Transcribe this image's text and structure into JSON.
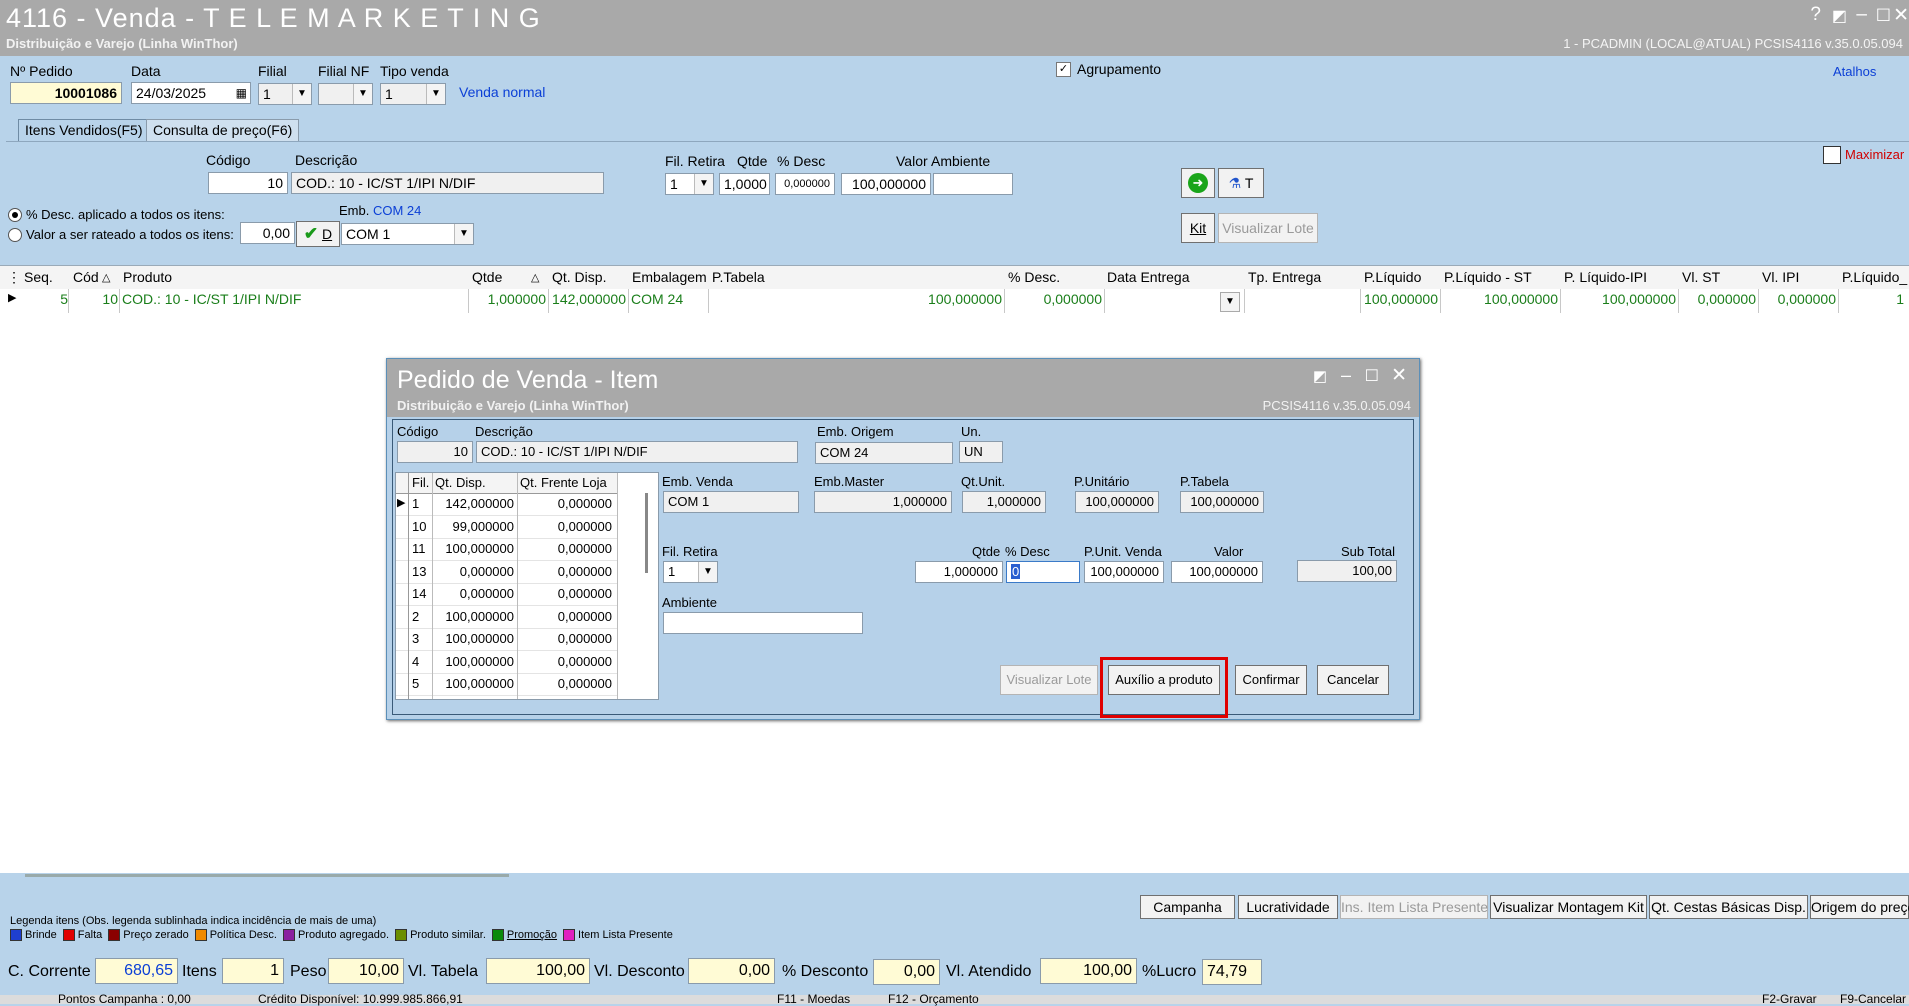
{
  "window": {
    "title": "4116 - Venda - T E L E M A R K E T I N G",
    "subtitle": "Distribuição e Varejo (Linha WinThor)",
    "right_info": "1 - PCADMIN (LOCAL@ATUAL)   PCSIS4116  v.35.0.05.094",
    "help": "?"
  },
  "header": {
    "pedido_label": "Nº Pedido",
    "pedido_value": "10001086",
    "data_label": "Data",
    "data_value": "24/03/2025",
    "filial_label": "Filial",
    "filial_value": "1",
    "filialnf_label": "Filial NF",
    "filialnf_value": "",
    "tipovenda_label": "Tipo venda",
    "tipovenda_value": "1",
    "tipovenda_desc": "Venda normal",
    "agrupamento_label": "Agrupamento",
    "atalhos_label": "Atalhos"
  },
  "tabs": [
    {
      "label": "Itens Vendidos(F5)"
    },
    {
      "label": "Consulta de preço(F6)"
    }
  ],
  "entry": {
    "codigo_label": "Código",
    "codigo_value": "10",
    "descricao_label": "Descrição",
    "descricao_value": "COD.: 10 - IC/ST 1/IPI N/DIF",
    "filretira_label": "Fil. Retira",
    "filretira_value": "1",
    "qtde_label": "Qtde",
    "qtde_value": "1,0000",
    "desc_label": "% Desc",
    "desc_value": "0,000000",
    "valor_label": "Valor",
    "valor_value": "100,000000",
    "ambiente_label": "Ambiente",
    "ambiente_value": "",
    "maximizar_label": "Maximizar",
    "radio1_label": "% Desc. aplicado a todos os itens:",
    "radio2_label": "Valor a ser rateado a todos os itens:",
    "rateio_value": "0,00",
    "d_label": "D",
    "emb_label": "Emb.",
    "emb_value_label": "COM 24",
    "emb_combo_value": "COM 1",
    "t_label": "T",
    "kit_label": "Kit",
    "visualizar_lote_label": "Visualizar Lote"
  },
  "grid": {
    "headers": [
      "Seq.",
      "Cód",
      "Produto",
      "Qtde",
      "Qt. Disp.",
      "Embalagem",
      "P.Tabela",
      "% Desc.",
      "Data Entrega",
      "Tp. Entrega",
      "P.Líquido",
      "P.Líquido - ST",
      "P. Líquido-IPI",
      "Vl. ST",
      "Vl. IPI",
      "P.Líquido_"
    ],
    "row": [
      "5",
      "10",
      "COD.: 10 - IC/ST 1/IPI N/DIF",
      "1,000000",
      "142,000000",
      "COM 24",
      "100,000000",
      "0,000000",
      "",
      "",
      "100,000000",
      "100,000000",
      "100,000000",
      "0,000000",
      "0,000000",
      "1"
    ]
  },
  "dialog": {
    "title": "Pedido de Venda - Item",
    "subtitle": "Distribuição e Varejo (Linha WinThor)",
    "version": "PCSIS4116  v.35.0.05.094",
    "codigo_label": "Código",
    "codigo_value": "10",
    "descricao_label": "Descrição",
    "descricao_value": "COD.: 10 - IC/ST 1/IPI N/DIF",
    "emborigem_label": "Emb. Origem",
    "emborigem_value": "COM 24",
    "un_label": "Un.",
    "un_value": "UN",
    "stock_headers": [
      "Fil.",
      "Qt. Disp.",
      "Qt. Frente Loja"
    ],
    "stock_rows": [
      [
        "1",
        "142,000000",
        "0,000000"
      ],
      [
        "10",
        "99,000000",
        "0,000000"
      ],
      [
        "11",
        "100,000000",
        "0,000000"
      ],
      [
        "13",
        "0,000000",
        "0,000000"
      ],
      [
        "14",
        "0,000000",
        "0,000000"
      ],
      [
        "2",
        "100,000000",
        "0,000000"
      ],
      [
        "3",
        "100,000000",
        "0,000000"
      ],
      [
        "4",
        "100,000000",
        "0,000000"
      ],
      [
        "5",
        "100,000000",
        "0,000000"
      ]
    ],
    "embvenda_label": "Emb. Venda",
    "embvenda_value": "COM 1",
    "embmaster_label": "Emb.Master",
    "embmaster_value": "1,000000",
    "qtunit_label": "Qt.Unit.",
    "qtunit_value": "1,000000",
    "punitario_label": "P.Unitário",
    "punitario_value": "100,000000",
    "ptabela_label": "P.Tabela",
    "ptabela_value": "100,000000",
    "filretira_label": "Fil. Retira",
    "filretira_value": "1",
    "qtde_label": "Qtde",
    "qtde_value": "1,000000",
    "desc_label": "% Desc",
    "desc_value": "0",
    "punitvenda_label": "P.Unit. Venda",
    "punitvenda_value": "100,000000",
    "valor_label": "Valor",
    "valor_value": "100,000000",
    "subtotal_label": "Sub Total",
    "subtotal_value": "100,00",
    "ambiente_label": "Ambiente",
    "ambiente_value": "",
    "btn_visualizar": "Visualizar Lote",
    "btn_auxilio": "Auxílio a produto",
    "btn_confirmar": "Confirmar",
    "btn_cancelar": "Cancelar"
  },
  "bottom_buttons": [
    "Campanha",
    "Lucratividade",
    "Ins. Item Lista Presente",
    "Visualizar Montagem Kit",
    "Qt. Cestas Básicas Disp.",
    "Origem do preço"
  ],
  "legend": {
    "title": "Legenda itens (Obs. legenda sublinhada indica incidência de mais de uma)",
    "items": [
      {
        "label": "Brinde",
        "color": "#1f3fcf"
      },
      {
        "label": "Falta",
        "color": "#e00000"
      },
      {
        "label": "Preço zerado",
        "color": "#8b0000"
      },
      {
        "label": "Política Desc.",
        "color": "#f08a00"
      },
      {
        "label": "Produto agregado.",
        "color": "#8a1fa0"
      },
      {
        "label": "Produto similar.",
        "color": "#6b8e00"
      },
      {
        "label": "Promoção",
        "color": "#0a8a0a"
      },
      {
        "label": "Item Lista Presente",
        "color": "#e020c0"
      }
    ]
  },
  "totals": {
    "ccorrente_label": "C. Corrente",
    "ccorrente_value": "680,65",
    "itens_label": "Itens",
    "itens_value": "1",
    "peso_label": "Peso",
    "peso_value": "10,00",
    "vltabela_label": "Vl. Tabela",
    "vltabela_value": "100,00",
    "vldesconto_label": "Vl. Desconto",
    "vldesconto_value": "0,00",
    "pdesconto_label": "% Desconto",
    "pdesconto_value": "0,00",
    "vlatendido_label": "Vl. Atendido",
    "vlatendido_value": "100,00",
    "lucro_label": "%Lucro",
    "lucro_value": "74,79"
  },
  "statusbar": {
    "pontos": "Pontos Campanha : 0,00",
    "credito": "Crédito Disponível: 10.999.985.866,91",
    "f11": "F11 - Moedas",
    "f12": "F12 - Orçamento",
    "f2": "F2-Gravar",
    "f9": "F9-Cancelar"
  },
  "colors": {
    "highlight": "#e00000",
    "accent_blue": "#0b3fd6",
    "grid_text": "#1a7e1a"
  }
}
